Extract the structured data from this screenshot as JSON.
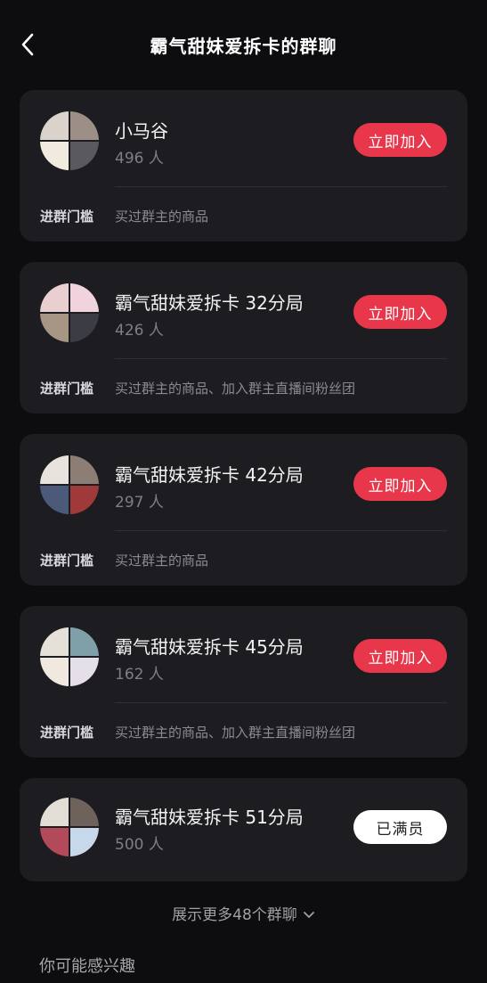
{
  "header": {
    "title": "霸气甜妹爱拆卡的群聊",
    "back_icon": "chevron-left-icon"
  },
  "groups": [
    {
      "name": "小马谷",
      "members": "496 人",
      "action": "立即加入",
      "action_type": "join",
      "threshold_label": "进群门槛",
      "threshold_value": "买过群主的商品",
      "avatar_colors": [
        "#d9d3cb",
        "#9c8f85",
        "#f1ebdf",
        "#5a5a5e"
      ]
    },
    {
      "name": "霸气甜妹爱拆卡 32分局",
      "members": "426 人",
      "action": "立即加入",
      "action_type": "join",
      "threshold_label": "进群门槛",
      "threshold_value": "买过群主的商品、加入群主直播间粉丝团",
      "avatar_colors": [
        "#e9cfd0",
        "#f0d3dc",
        "#a89684",
        "#3c3c44"
      ]
    },
    {
      "name": "霸气甜妹爱拆卡 42分局",
      "members": "297 人",
      "action": "立即加入",
      "action_type": "join",
      "threshold_label": "进群门槛",
      "threshold_value": "买过群主的商品",
      "avatar_colors": [
        "#e8e3dc",
        "#8c7e74",
        "#4a5a78",
        "#a03a3a"
      ]
    },
    {
      "name": "霸气甜妹爱拆卡 45分局",
      "members": "162 人",
      "action": "立即加入",
      "action_type": "join",
      "threshold_label": "进群门槛",
      "threshold_value": "买过群主的商品、加入群主直播间粉丝团",
      "avatar_colors": [
        "#e5e0d8",
        "#7fa0a8",
        "#f1e9e0",
        "#e4dfe8"
      ]
    },
    {
      "name": "霸气甜妹爱拆卡 51分局",
      "members": "500 人",
      "action": "已满员",
      "action_type": "full",
      "threshold_label": "",
      "threshold_value": "",
      "avatar_colors": [
        "#e2ddd5",
        "#6e625a",
        "#b24a5a",
        "#c7d8ea"
      ]
    }
  ],
  "show_more": {
    "label": "展示更多48个群聊",
    "icon": "chevron-down-icon"
  },
  "interest": {
    "title": "你可能感兴趣"
  }
}
